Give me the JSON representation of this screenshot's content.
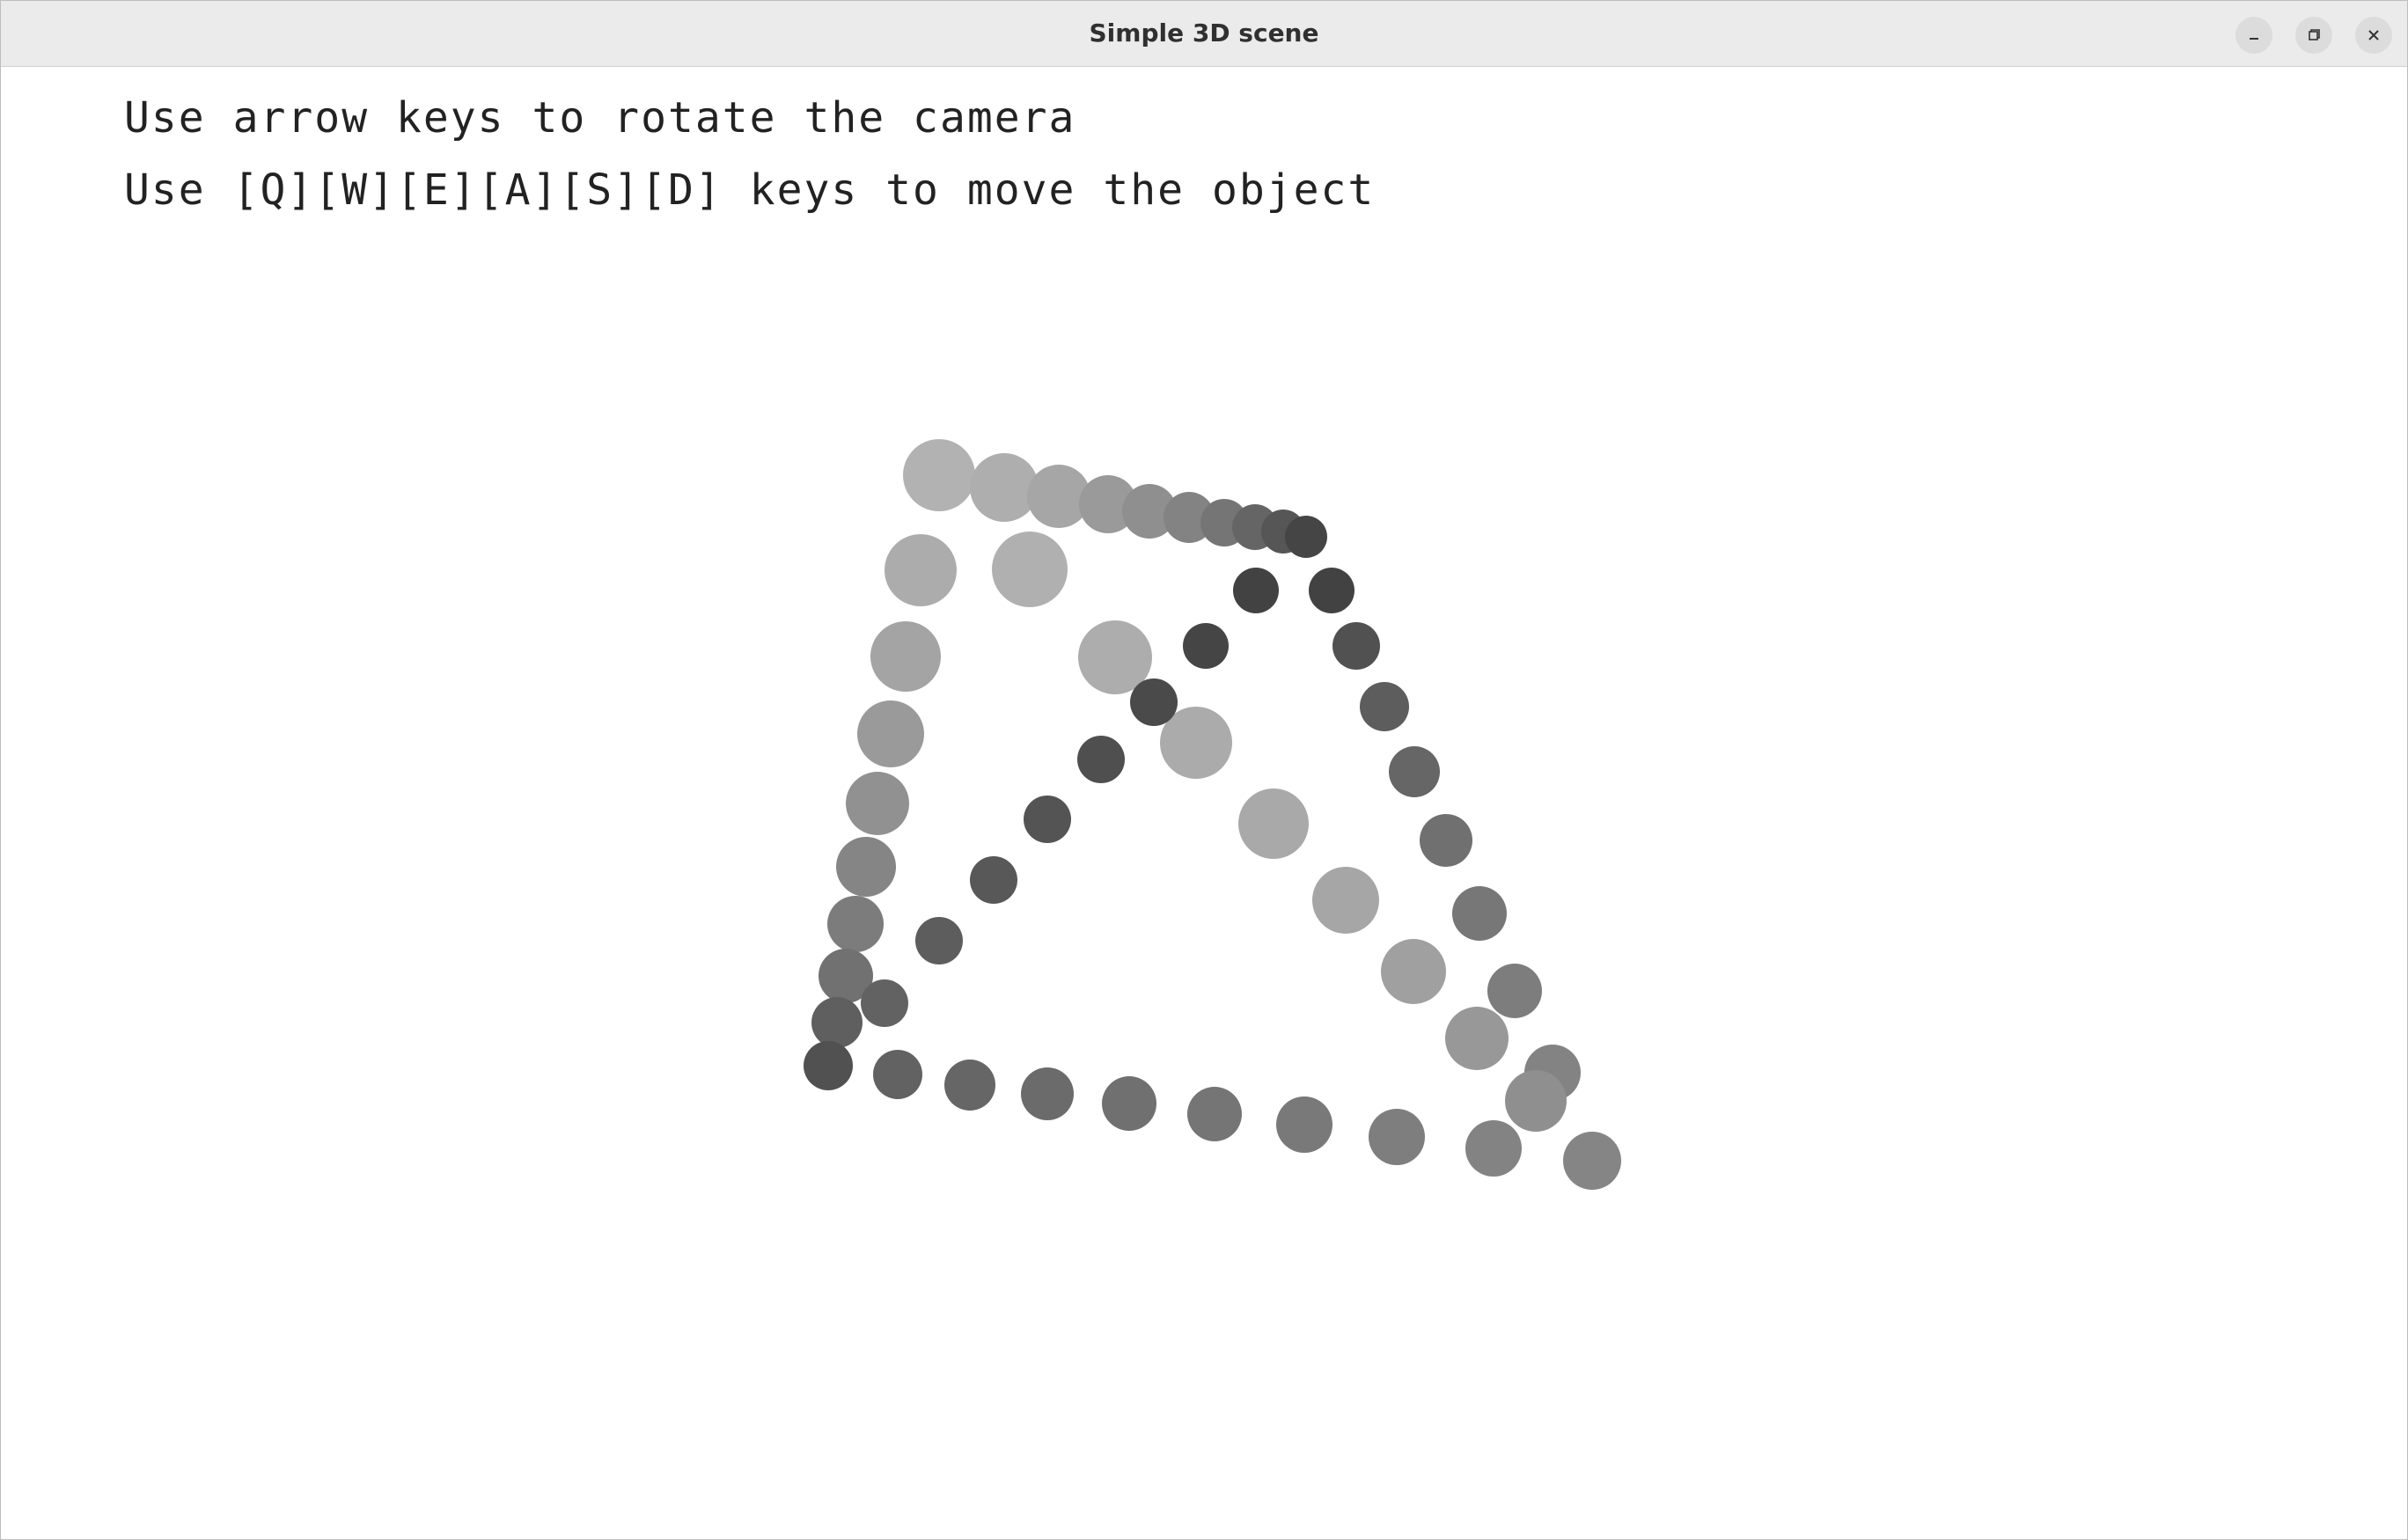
{
  "window": {
    "title": "Simple 3D scene",
    "buttons": {
      "minimize_icon": "minimize-icon",
      "maximize_icon": "maximize-icon",
      "close_icon": "close-icon"
    }
  },
  "instructions": {
    "line1": "Use arrow keys to rotate the camera",
    "line2": "Use [Q][W][E][A][S][D] keys to move the object"
  },
  "scene": {
    "object": "spheres forming a rotated cube wireframe",
    "colors": {
      "near": "#b0b0b0",
      "mid": "#808080",
      "far": "#3c3c3c"
    }
  }
}
